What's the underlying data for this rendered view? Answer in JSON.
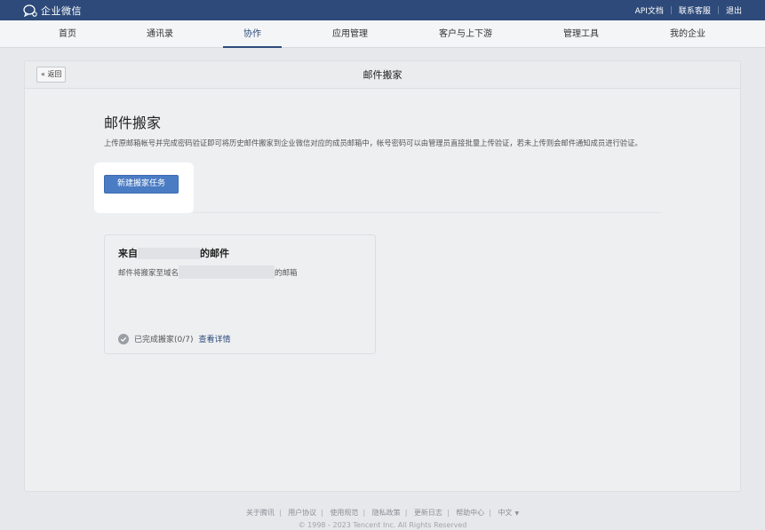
{
  "topbar": {
    "brand": "企业微信",
    "links": [
      "API文档",
      "联系客服",
      "退出"
    ]
  },
  "nav": {
    "items": [
      "首页",
      "通讯录",
      "协作",
      "应用管理",
      "客户与上下游",
      "管理工具",
      "我的企业"
    ],
    "active": "协作"
  },
  "page": {
    "back_label": "« 返回",
    "header_title": "邮件搬家",
    "section_title": "邮件搬家",
    "description": "上传原邮箱帐号并完成密码验证即可将历史邮件搬家到企业微信对应的成员邮箱中，帐号密码可以由管理员直接批量上传验证，若未上传则会邮件通知成员进行验证。",
    "new_task_button": "新建搬家任务"
  },
  "task": {
    "title_prefix": "来自",
    "title_suffix": "的邮件",
    "subtitle_prefix": "邮件将搬家至域名",
    "subtitle_suffix": "的邮箱",
    "status": "已完成搬家(0/7)",
    "detail_link": "查看详情"
  },
  "footer": {
    "links": [
      "关于腾讯",
      "用户协议",
      "使用规范",
      "隐私政策",
      "更新日志",
      "帮助中心",
      "中文"
    ],
    "copyright": "© 1998 - 2023 Tencent Inc. All Rights Reserved"
  },
  "colors": {
    "topbar": "#2d4a7a",
    "accent": "#2d4a7a",
    "primary_button": "#4a7cc4",
    "page_bg": "#e6e8eb"
  }
}
